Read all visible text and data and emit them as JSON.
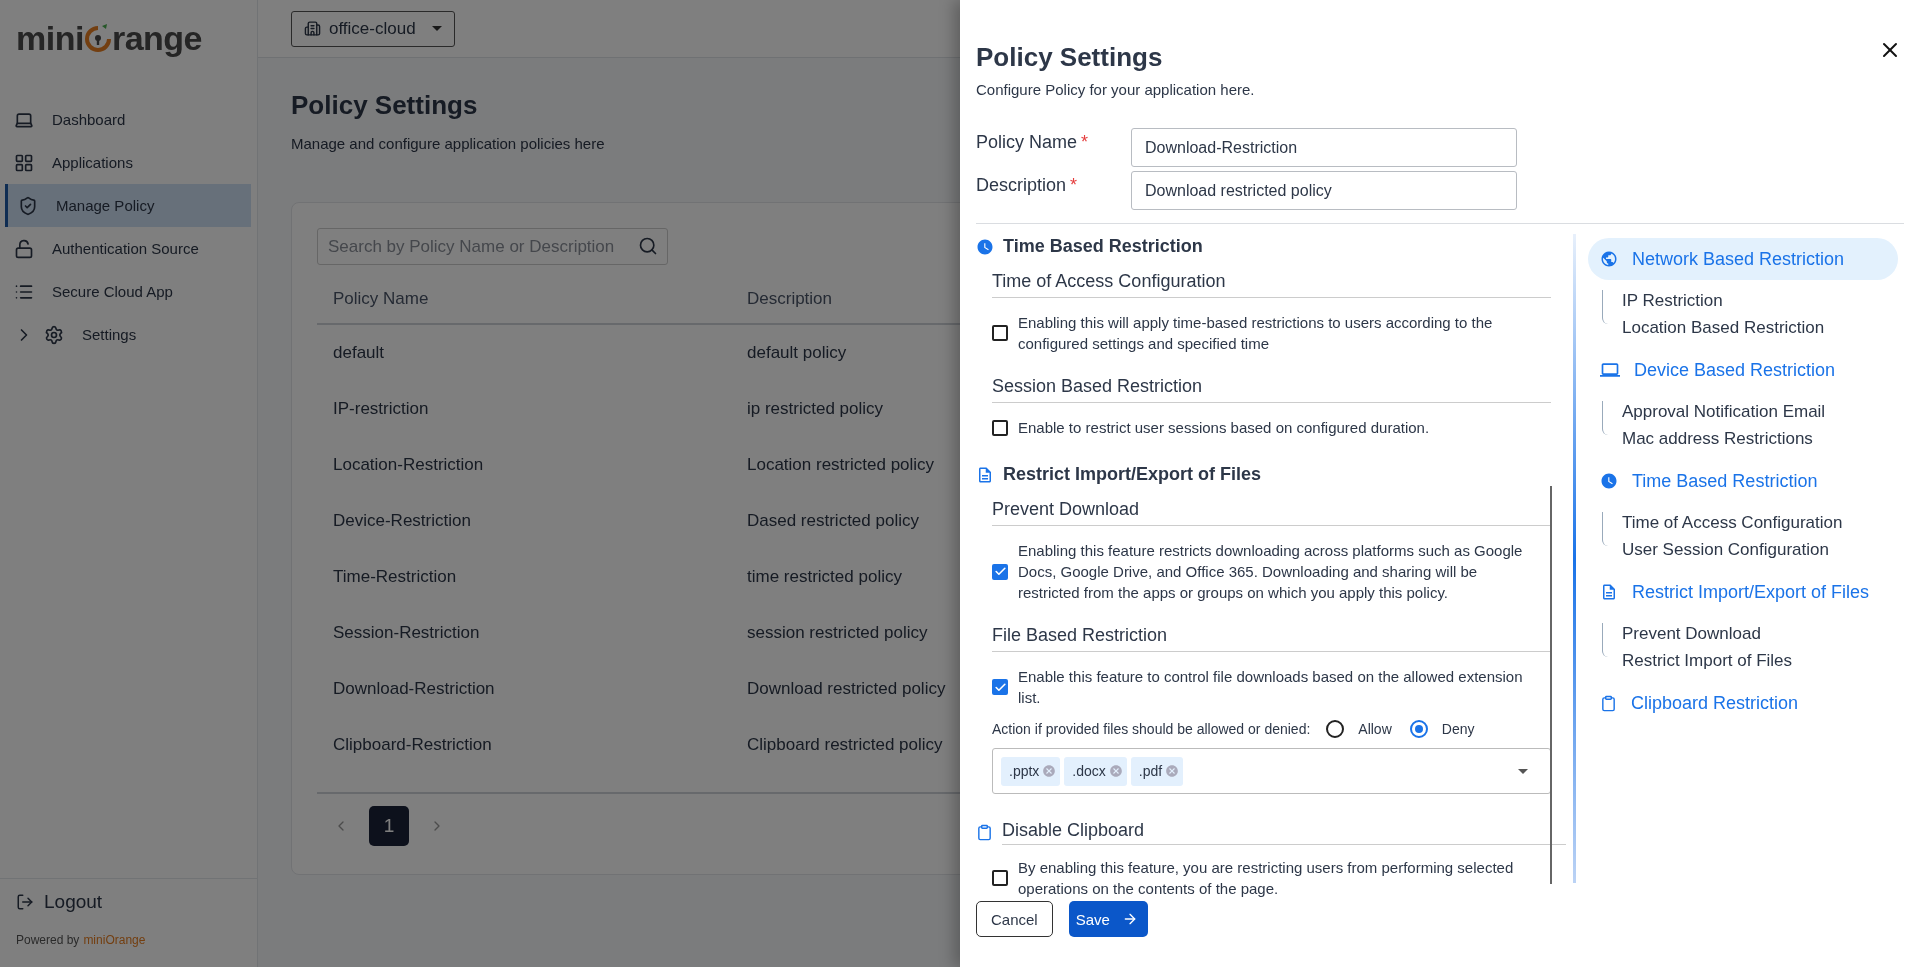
{
  "sidebar": {
    "logo": {
      "before": "mini",
      "after": "range"
    },
    "items": [
      {
        "label": "Dashboard",
        "selected": false
      },
      {
        "label": "Applications",
        "selected": false
      },
      {
        "label": "Manage Policy",
        "selected": true
      },
      {
        "label": "Authentication Source",
        "selected": false
      },
      {
        "label": "Secure Cloud App",
        "selected": false
      },
      {
        "label": "Settings",
        "selected": false,
        "expanded": false
      }
    ],
    "logout": "Logout",
    "powered_by": "Powered by",
    "brand": "miniOrange"
  },
  "topbar": {
    "org_selector": "office-cloud"
  },
  "page": {
    "title": "Policy Settings",
    "subtitle": "Manage and configure application policies here"
  },
  "table": {
    "search": {
      "placeholder": "Search by Policy Name or Description"
    },
    "columns": [
      "Policy Name",
      "Description"
    ],
    "rows": [
      [
        "default",
        "default policy"
      ],
      [
        "IP-restriction",
        "ip restricted policy"
      ],
      [
        "Location-Restriction",
        "Location restricted policy"
      ],
      [
        "Device-Restriction",
        "Dased restricted policy"
      ],
      [
        "Time-Restriction",
        "time restricted policy"
      ],
      [
        "Session-Restriction",
        "session restricted policy"
      ],
      [
        "Download-Restriction",
        "Download restricted policy"
      ],
      [
        "Clipboard-Restriction",
        "Clipboard restricted policy"
      ]
    ],
    "pages": [
      {
        "label": "1",
        "selected": true
      }
    ]
  },
  "drawer": {
    "title": "Policy Settings",
    "subtitle": "Configure Policy for your application here.",
    "fields": [
      {
        "label": "Policy Name",
        "required_mark": "*",
        "value": "Download-Restriction"
      },
      {
        "label": "Description",
        "required_mark": "*",
        "value": "Download restricted policy"
      }
    ],
    "sections": [
      {
        "kind": "group",
        "title": "Time Based Restriction",
        "subsections": [
          {
            "title": "Time of Access Configuration",
            "checked": false,
            "text": "Enabling this will apply time-based restrictions to users according to the configured settings and specified time"
          },
          {
            "title": "Session Based Restriction",
            "checked": false,
            "text": "Enable to restrict user sessions based on configured duration."
          }
        ]
      },
      {
        "kind": "group",
        "title": "Restrict Import/Export of Files",
        "subsections": [
          {
            "title": "Prevent Download",
            "checked": true,
            "text": "Enabling this feature restricts downloading across platforms such as Google Docs, Google Drive, and Office 365. Downloading and sharing will be restricted from the apps or groups on which you apply this policy."
          },
          {
            "title": "File Based Restriction",
            "checked": true,
            "text": "Enable this feature to control file downloads based on the allowed extension list.",
            "action": {
              "label": "Action if provided files should be allowed or denied:",
              "options": [
                {
                  "label": "Allow",
                  "selected": false
                },
                {
                  "label": "Deny",
                  "selected": true
                }
              ]
            },
            "tags": [
              ".pptx",
              ".docx",
              ".pdf"
            ]
          }
        ]
      },
      {
        "kind": "single",
        "title": "Disable Clipboard",
        "subsections": [
          {
            "checked": false,
            "text": "By enabling this feature, you are restricting users from performing selected operations on the contents of the page."
          }
        ]
      }
    ],
    "nav": [
      {
        "label": "Network Based Restriction",
        "selected": true,
        "children": [
          "IP Restriction",
          "Location Based Restriction"
        ]
      },
      {
        "label": "Device Based Restriction",
        "selected": false,
        "children": [
          "Approval Notification Email",
          "Mac address Restrictions"
        ]
      },
      {
        "label": "Time Based Restriction",
        "selected": false,
        "children": [
          "Time of Access Configuration",
          "User Session Configuration"
        ]
      },
      {
        "label": "Restrict Import/Export of Files",
        "selected": false,
        "children": [
          "Prevent Download",
          "Restrict Import of Files"
        ]
      },
      {
        "label": "Clipboard Restriction",
        "selected": false
      }
    ],
    "buttons": {
      "cancel": "Cancel",
      "save": "Save"
    }
  }
}
